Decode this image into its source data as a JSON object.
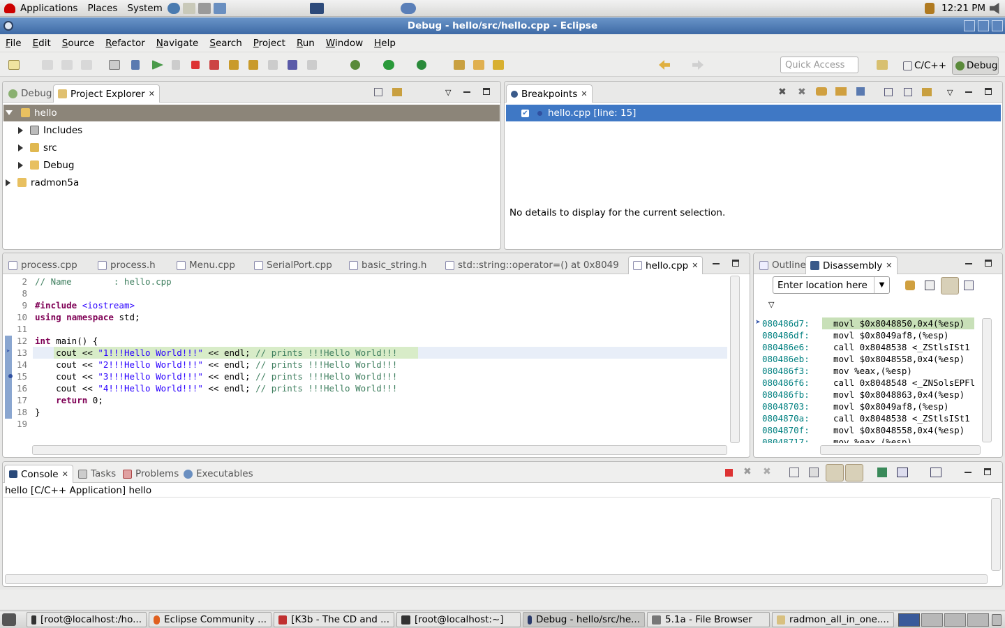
{
  "topbar": {
    "menus": [
      "Applications",
      "Places",
      "System"
    ],
    "clock": "12:21 PM"
  },
  "window": {
    "title": "Debug - hello/src/hello.cpp - Eclipse"
  },
  "menubar": [
    "File",
    "Edit",
    "Source",
    "Refactor",
    "Navigate",
    "Search",
    "Project",
    "Run",
    "Window",
    "Help"
  ],
  "toolbar": {
    "quick_access_placeholder": "Quick Access",
    "perspectives": [
      "C/C++",
      "Debug"
    ]
  },
  "left_top": {
    "tabs": [
      "Debug",
      "Project Explorer"
    ],
    "tree": [
      {
        "label": "hello",
        "expanded": true,
        "level": 0
      },
      {
        "label": "Includes",
        "expanded": false,
        "level": 1
      },
      {
        "label": "src",
        "expanded": false,
        "level": 1
      },
      {
        "label": "Debug",
        "expanded": false,
        "level": 1
      },
      {
        "label": "radmon5a",
        "expanded": false,
        "level": 0
      }
    ]
  },
  "breakpoints": {
    "tab": "Breakpoints",
    "items": [
      "hello.cpp [line: 15]"
    ],
    "details": "No details to display for the current selection."
  },
  "editor": {
    "tabs": [
      "process.cpp",
      "process.h",
      "Menu.cpp",
      "SerialPort.cpp",
      "basic_string.h",
      "std::string::operator=() at 0x8049",
      "hello.cpp"
    ],
    "active_tab": "hello.cpp",
    "line_numbers": [
      "2",
      "8",
      "9",
      "10",
      "11",
      "12",
      "13",
      "14",
      "15",
      "16",
      "17",
      "18",
      "19"
    ],
    "lines": {
      "l2": "// Name        : hello.cpp",
      "l9_kw": "#include",
      "l9_inc": "<iostream>",
      "l10_a": "using",
      "l10_b": "namespace",
      "l10_c": "std;",
      "l12_kw": "int",
      "l12_rest": "main() {",
      "cout": "cout <<",
      "s1": "\"1!!!Hello World!!!\"",
      "s2": "\"2!!!Hello World!!!\"",
      "s3": "\"3!!!Hello World!!!\"",
      "s4": "\"4!!!Hello World!!!\"",
      "endl": "<< endl;",
      "comment": "// prints !!!Hello World!!!",
      "ret_kw": "return",
      "ret_val": "0;",
      "close": "}"
    }
  },
  "disassembly": {
    "tabs": [
      "Outline",
      "Disassembly"
    ],
    "location_placeholder": "Enter location here",
    "rows": [
      {
        "addr": "080486d7:",
        "instr": "movl $0x8048850,0x4(%esp)"
      },
      {
        "addr": "080486df:",
        "instr": "movl $0x8049af8,(%esp)"
      },
      {
        "addr": "080486e6:",
        "instr": "call 0x8048538 <_ZStlsISt1"
      },
      {
        "addr": "080486eb:",
        "instr": "movl $0x8048558,0x4(%esp)"
      },
      {
        "addr": "080486f3:",
        "instr": "mov %eax,(%esp)"
      },
      {
        "addr": "080486f6:",
        "instr": "call 0x8048548 <_ZNSolsEPFl"
      },
      {
        "addr": "080486fb:",
        "instr": "movl $0x8048863,0x4(%esp)"
      },
      {
        "addr": "08048703:",
        "instr": "movl $0x8049af8,(%esp)"
      },
      {
        "addr": "0804870a:",
        "instr": "call 0x8048538 <_ZStlsISt1"
      },
      {
        "addr": "0804870f:",
        "instr": "movl $0x8048558,0x4(%esp)"
      },
      {
        "addr": "08048717:",
        "instr": "mov %eax,(%esp)"
      }
    ]
  },
  "console": {
    "tabs": [
      "Console",
      "Tasks",
      "Problems",
      "Executables"
    ],
    "header": "hello [C/C++ Application] hello"
  },
  "taskbar": [
    "[root@localhost:/ho...",
    "Eclipse Community ...",
    "[K3b - The CD and ...",
    "[root@localhost:~]",
    "Debug - hello/src/he...",
    "5.1a - File Browser",
    "radmon_all_in_one...."
  ]
}
